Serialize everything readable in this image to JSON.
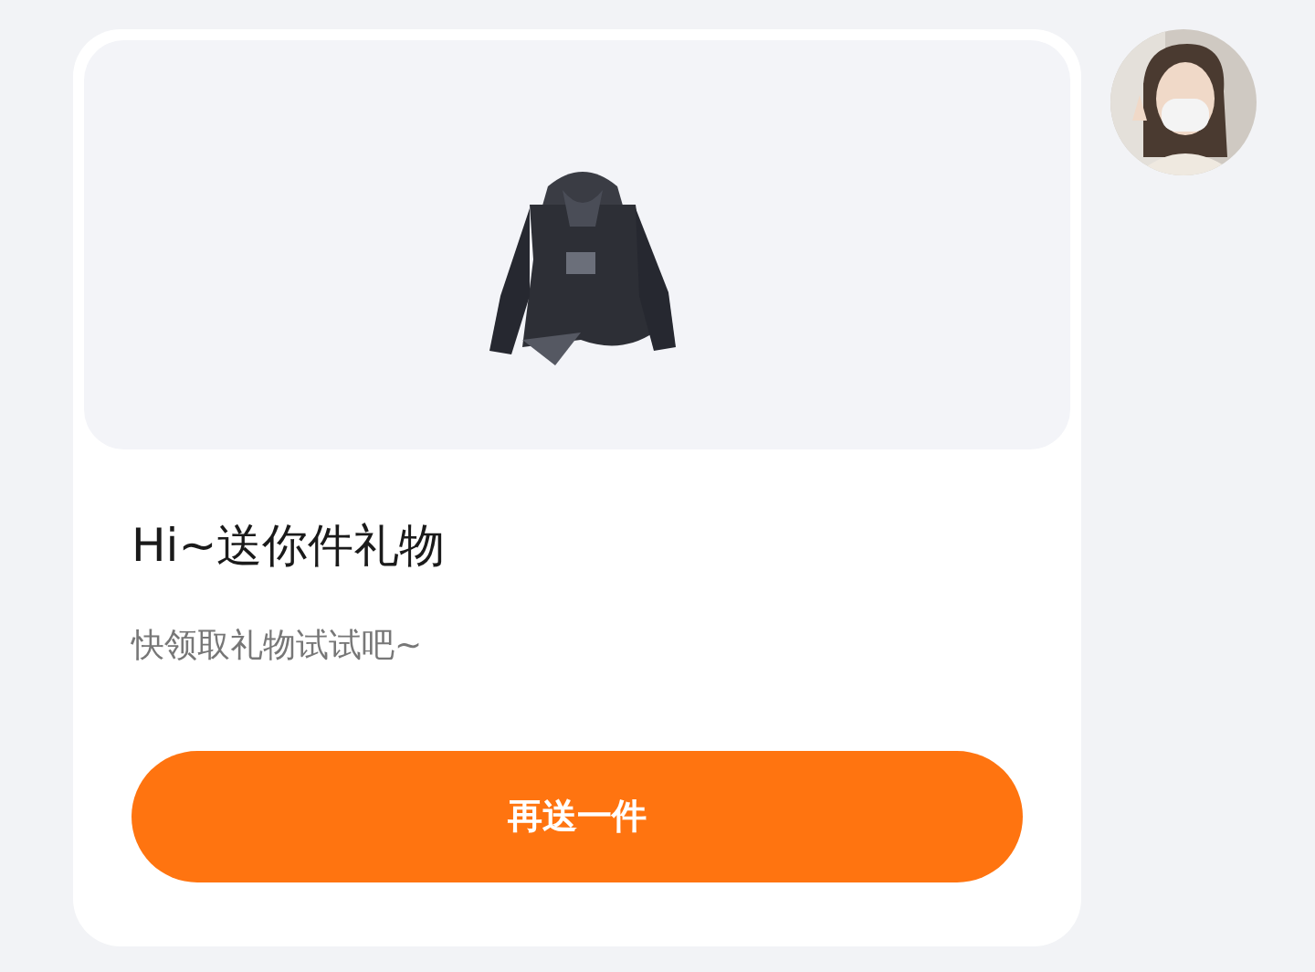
{
  "gift_card": {
    "title": "Hi~送你件礼物",
    "subtitle": "快领取礼物试试吧~",
    "button": "再送一件"
  }
}
